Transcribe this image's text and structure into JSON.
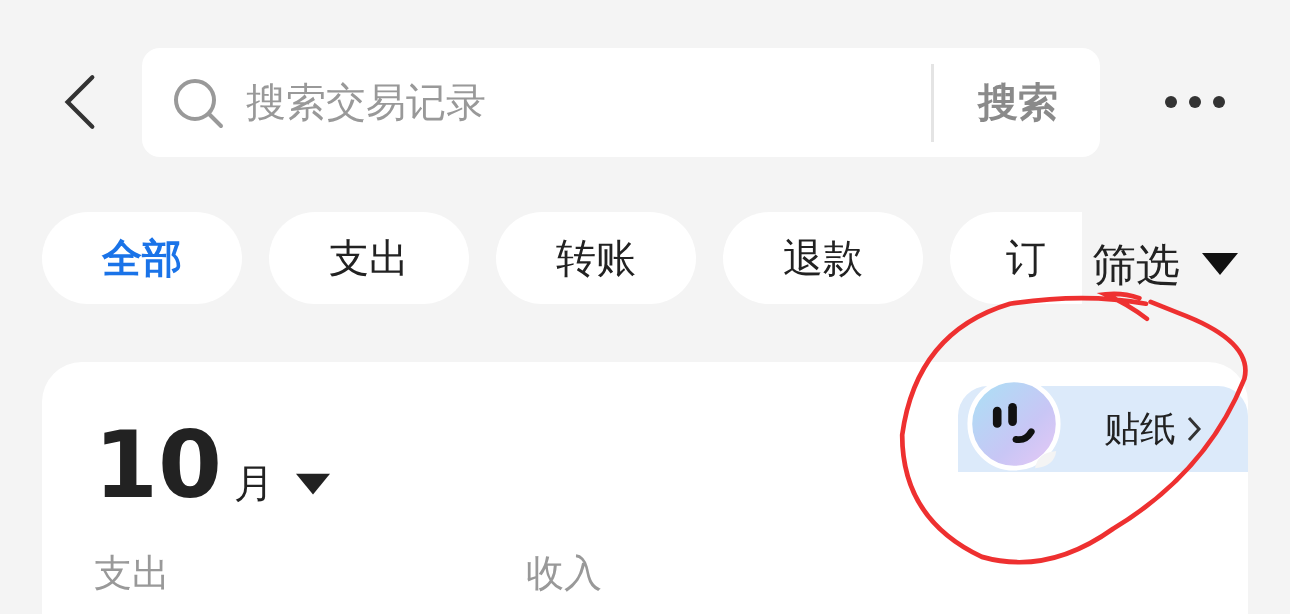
{
  "search": {
    "placeholder": "搜索交易记录",
    "button": "搜索"
  },
  "filters": [
    {
      "label": "全部",
      "selected": true
    },
    {
      "label": "支出",
      "selected": false
    },
    {
      "label": "转账",
      "selected": false
    },
    {
      "label": "退款",
      "selected": false
    },
    {
      "label": "订",
      "selected": false
    }
  ],
  "filter_menu": "筛选",
  "summary": {
    "month": "10",
    "month_unit": "月",
    "sticker": "贴纸",
    "stats": [
      {
        "label": "支出"
      },
      {
        "label": "收入"
      }
    ]
  }
}
